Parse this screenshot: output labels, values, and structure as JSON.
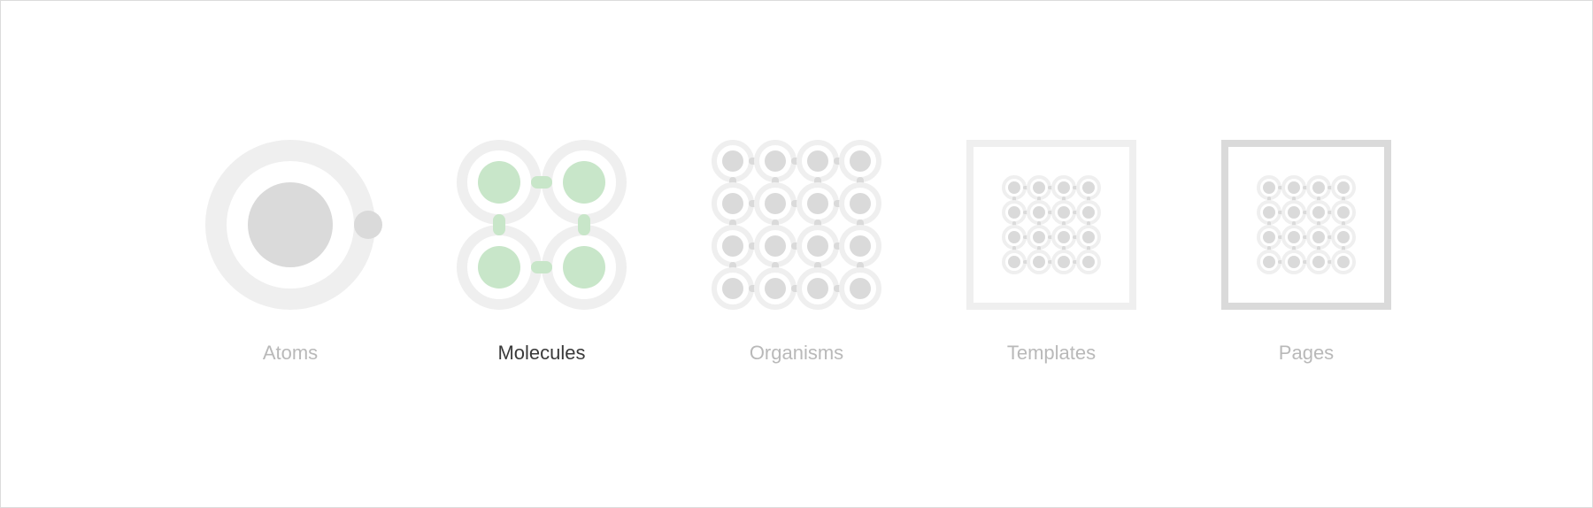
{
  "stages": [
    {
      "key": "atoms",
      "label": "Atoms",
      "active": false
    },
    {
      "key": "molecules",
      "label": "Molecules",
      "active": true
    },
    {
      "key": "organisms",
      "label": "Organisms",
      "active": false
    },
    {
      "key": "templates",
      "label": "Templates",
      "active": false
    },
    {
      "key": "pages",
      "label": "Pages",
      "active": false
    }
  ],
  "colors": {
    "ring": "#efefef",
    "core": "#dadada",
    "bond": "#dadada",
    "active_core": "#c8e6c9",
    "active_bond": "#c8e6c9",
    "frame_templates": "#efefef",
    "frame_pages": "#dadada",
    "label_active": "#3a3a3a",
    "label_inactive": "#b9b9b9"
  },
  "icons": {
    "atoms": "atom-icon",
    "molecules": "molecule-icon",
    "organisms": "organism-icon",
    "templates": "template-icon",
    "pages": "page-icon"
  }
}
